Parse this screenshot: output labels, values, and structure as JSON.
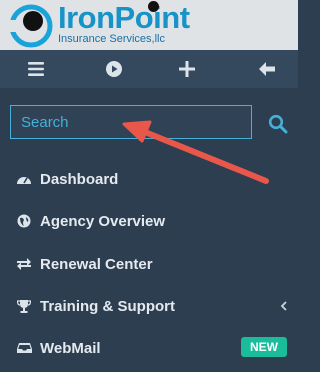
{
  "logo": {
    "brand": "IronPoint",
    "tagline": "Insurance Services,llc",
    "colors": {
      "brand": "#1793c8",
      "ring": "#1aa3d9"
    }
  },
  "toolbar": {
    "icons": [
      "menu-icon",
      "play-circle-icon",
      "plus-icon",
      "arrow-left-icon"
    ]
  },
  "search": {
    "placeholder": "Search"
  },
  "nav": {
    "items": [
      {
        "label": "Dashboard",
        "icon": "tachometer-icon"
      },
      {
        "label": "Agency Overview",
        "icon": "globe-icon"
      },
      {
        "label": "Renewal Center",
        "icon": "exchange-icon"
      },
      {
        "label": "Training & Support",
        "icon": "trophy-icon",
        "has_submenu": true
      },
      {
        "label": "WebMail",
        "icon": "inbox-icon",
        "badge": "NEW"
      }
    ]
  },
  "annotation": {
    "arrow_color": "#e8574a",
    "points_to": "search"
  },
  "colors": {
    "sidebar_bg": "#2c3e50",
    "toolbar_bg": "#34495e",
    "accent": "#45b0d8",
    "badge": "#1abc9c"
  }
}
